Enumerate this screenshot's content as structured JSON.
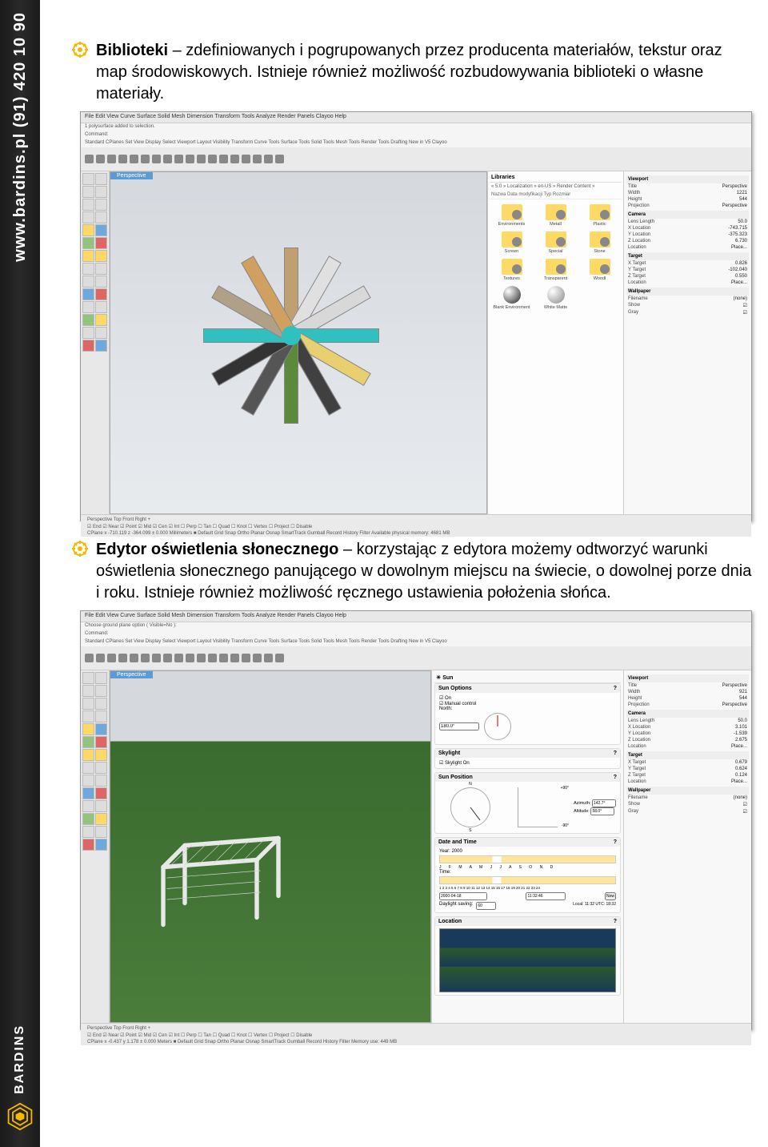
{
  "sidebar": {
    "url_phone": "www.bardins.pl (91) 420 10 90",
    "brand": "BARDINS"
  },
  "section1": {
    "title": "Biblioteki",
    "text": " – zdefiniowanych i pogrupowanych przez producenta materiałów, tekstur oraz map środowiskowych. Istnieje również możliwość rozbudowywania biblioteki o własne materiały."
  },
  "section2": {
    "title": "Edytor oświetlenia słonecznego",
    "text": " – korzystając z edytora możemy odtworzyć warunki oświetlenia słonecznego panującego w dowolnym miejscu na świecie, o dowolnej porze dnia i roku. Istnieje również możliwość ręcznego ustawienia położenia słońca."
  },
  "app1": {
    "menu": "File  Edit  View  Curve  Surface  Solid  Mesh  Dimension  Transform  Tools  Analyze  Render  Panels  Clayoo  Help",
    "status": "1 polysurface added to selection.",
    "command": "Command:",
    "tabs_top": "Standard  CPlanes  Set View  Display  Select  Viewport Layout  Visibility  Transform  Curve Tools  Surface Tools  Solid Tools  Mesh Tools  Render Tools  Drafting  New in V5  Clayoo",
    "viewport_label": "Perspective",
    "libraries": {
      "title": "Libraries",
      "path": "« 5.0 » Localization » en-US » Render Content »",
      "columns": "Nazwa     Data modyfikacji     Typ     Rozmiar",
      "items": [
        "Environments",
        "Metall",
        "Plastic",
        "Screen",
        "Special",
        "Stone",
        "Textures",
        "Transparent",
        "Woodl",
        "Blank Environment",
        "White Matte"
      ]
    },
    "properties": {
      "viewport_h": "Viewport",
      "title_l": "Title",
      "title_v": "Perspective",
      "width_l": "Width",
      "width_v": "1221",
      "height_l": "Height",
      "height_v": "544",
      "projection_l": "Projection",
      "projection_v": "Perspective",
      "camera_h": "Camera",
      "lens_l": "Lens Length",
      "lens_v": "50.0",
      "xloc_l": "X Location",
      "xloc_v": "-743.715",
      "yloc_l": "Y Location",
      "yloc_v": "-375.323",
      "zloc_l": "Z Location",
      "zloc_v": "6.730",
      "loc_l": "Location",
      "loc_v": "Place...",
      "target_h": "Target",
      "xt_l": "X Target",
      "xt_v": "0.826",
      "yt_l": "Y Target",
      "yt_v": "-102.040",
      "zt_l": "Z Target",
      "zt_v": "0.550",
      "tloc_l": "Location",
      "tloc_v": "Place...",
      "wallpaper_h": "Wallpaper",
      "file_l": "Filename",
      "file_v": "(none)",
      "show_l": "Show",
      "gray_l": "Gray"
    },
    "view_tabs": "Perspective  Top  Front  Right  +",
    "osnap": "☑ End ☑ Near ☑ Point ☑ Mid ☑ Cen ☑ Int ☐ Perp ☐ Tan ☐ Quad ☐ Knot ☐ Vertex ☐ Project ☐ Disable",
    "statusbar": "CPlane    x -710.119    z -364.099    ± 0.000    Millimeters    ■ Default        Grid Snap  Ortho  Planar  Osnap  SmartTrack  Gumball  Record History  Filter  Available physical memory: 4681 MB"
  },
  "app2": {
    "menu": "File  Edit  View  Curve  Surface  Solid  Mesh  Dimension  Transform  Tools  Analyze  Render  Panels  Clayoo  Help",
    "status": "Choose ground plane option ( Visible=No ):",
    "command": "Command:",
    "tabs_top": "Standard  CPlanes  Set View  Display  Select  Viewport Layout  Visibility  Transform  Curve Tools  Surface Tools  Solid Tools  Mesh Tools  Render Tools  Drafting  New in V5  Clayoo",
    "viewport_label": "Perspective",
    "sun": {
      "title": "Sun",
      "options_h": "Sun Options",
      "on": "On",
      "manual": "Manual control",
      "north_l": "North:",
      "north_v": "180.0°",
      "skylight_h": "Skylight",
      "skylight_on": "Skylight On",
      "position_h": "Sun Position",
      "az_l": "Azimuth:",
      "az_v": "142.7°",
      "alt_l": "Altitude:",
      "alt_v": "58.0°",
      "n": "+90°",
      "s": "-90°",
      "datetime_h": "Date and Time",
      "year_l": "Year: 2000",
      "months": "J  F  M  A  M  J  J  A  S  O  N  D",
      "time_l": "Time:",
      "hours": "1  2  3  4  5  6  7  8  9  10  11  12  13  14  15  16  17  18  19  20  21  22  23  24",
      "date_v": "2000-04-18",
      "clock_v": "11:32:46",
      "daylight_l": "Daylight saving:",
      "daylight_v": "60",
      "local_l": "Local: 11:32",
      "utc_l": "UTC: 18:32",
      "location_h": "Location",
      "now": "Now"
    },
    "properties": {
      "viewport_h": "Viewport",
      "title_l": "Title",
      "title_v": "Perspective",
      "width_l": "Width",
      "width_v": "921",
      "height_l": "Height",
      "height_v": "544",
      "projection_l": "Projection",
      "projection_v": "Perspective",
      "camera_h": "Camera",
      "lens_l": "Lens Length",
      "lens_v": "50.0",
      "xloc_l": "X Location",
      "xloc_v": "3.101",
      "yloc_l": "Y Location",
      "yloc_v": "-1.539",
      "zloc_l": "Z Location",
      "zloc_v": "2.675",
      "loc_l": "Location",
      "loc_v": "Place...",
      "target_h": "Target",
      "xt_l": "X Target",
      "xt_v": "0.679",
      "yt_l": "Y Target",
      "yt_v": "0.624",
      "zt_l": "Z Target",
      "zt_v": "0.124",
      "tloc_l": "Location",
      "tloc_v": "Place...",
      "wallpaper_h": "Wallpaper",
      "file_l": "Filename",
      "file_v": "(none)",
      "show_l": "Show",
      "gray_l": "Gray"
    },
    "view_tabs": "Perspective  Top  Front  Right  +",
    "osnap": "☑ End ☑ Near ☑ Point ☑ Mid ☑ Cen ☑ Int ☐ Perp ☐ Tan ☐ Quad ☐ Knot ☐ Vertex ☐ Project ☐ Disable",
    "statusbar": "CPlane    x -0.437    y 1.178    ± 0.000    Meters    ■ Default        Grid Snap  Ortho  Planar  Osnap  SmartTrack  Gumball  Record History  Filter  Memory use: 449 MB"
  }
}
